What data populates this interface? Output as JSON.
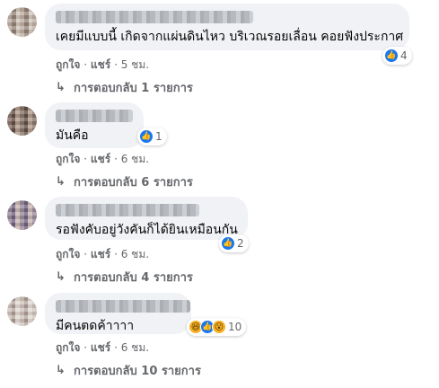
{
  "comments": [
    {
      "text": "เคยมีแบบนี้ เกิดจากแผ่นดินไหว บริเวณรอยเลื่อน คอยฟังประกาศ",
      "reactions": [
        "like"
      ],
      "reaction_count": "4",
      "like_label": "ถูกใจ",
      "reply_label": "แชร์",
      "separator": "·",
      "time": "5 ชม.",
      "replies_label": "การตอบกลับ 1 รายการ"
    },
    {
      "text": "มันคือ",
      "reactions": [
        "like"
      ],
      "reaction_count": "1",
      "like_label": "ถูกใจ",
      "reply_label": "แชร์",
      "separator": "·",
      "time": "6 ชม.",
      "replies_label": "การตอบกลับ 6 รายการ"
    },
    {
      "text": "รอฟังคับอยู่วังคันก็ได้ยินเหมือนกัน",
      "reactions": [
        "like"
      ],
      "reaction_count": "2",
      "like_label": "ถูกใจ",
      "reply_label": "แชร์",
      "separator": "·",
      "time": "6 ชม.",
      "replies_label": "การตอบกลับ 4 รายการ"
    },
    {
      "text": "มีคนตดค้าาาา",
      "reactions": [
        "haha",
        "like",
        "wow"
      ],
      "reaction_count": "10",
      "like_label": "ถูกใจ",
      "reply_label": "แชร์",
      "separator": "·",
      "time": "6 ชม.",
      "replies_label": "การตอบกลับ 10 รายการ"
    }
  ],
  "icons": {
    "reply_arrow": "reply-arrow-icon",
    "like": "like-icon",
    "haha": "haha-icon",
    "wow": "wow-icon"
  },
  "colors": {
    "bubble": "#f0f2f5",
    "meta_text": "#65676b",
    "like_blue": "#1877f2",
    "emoji_yellow": "#f7b125"
  }
}
